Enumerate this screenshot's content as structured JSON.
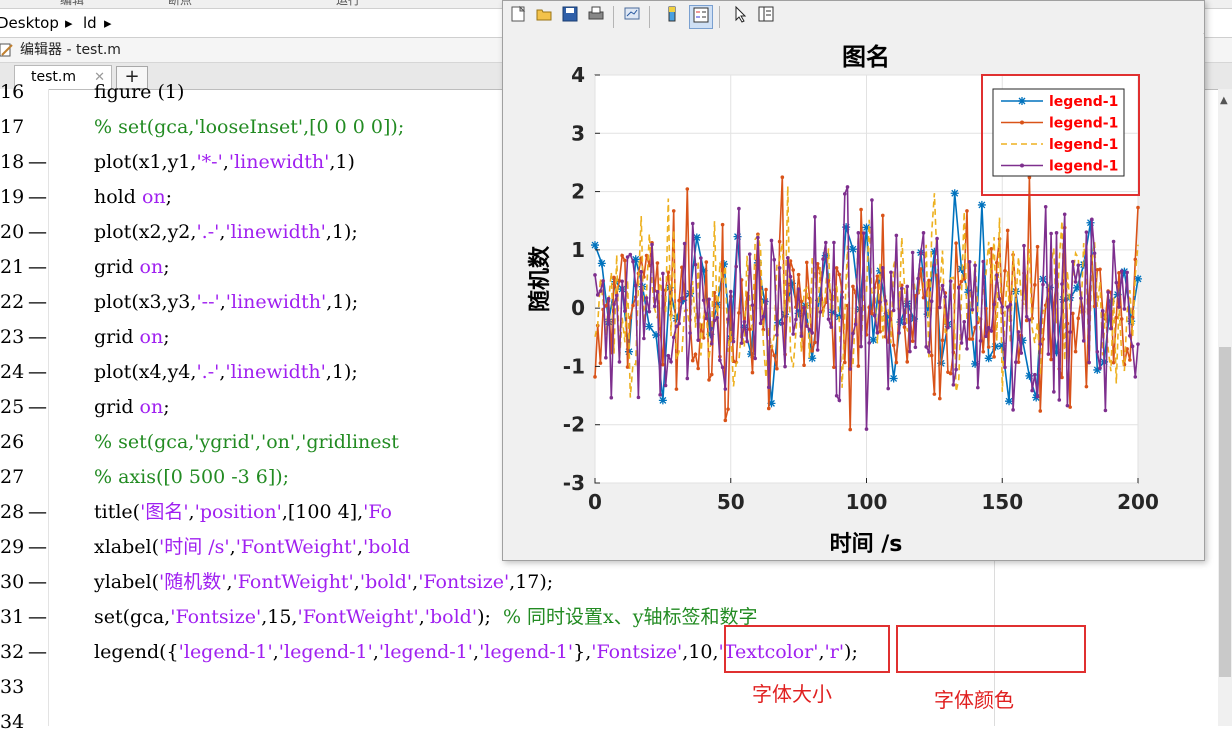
{
  "top_menu": [
    "编辑",
    "断点",
    "运行"
  ],
  "address_bar": {
    "crumbs": [
      "Desktop",
      "ld"
    ],
    "separator": "▸"
  },
  "editor": {
    "window_title": "编辑器 - test.m",
    "tab_label": "test.m",
    "tab_close": "✕",
    "new_tab": "+"
  },
  "code_lines": [
    {
      "ln": "16",
      "dash": "",
      "html": "figure (1)"
    },
    {
      "ln": "17",
      "dash": "",
      "html": "<span class=\"cm\">% set(gca,'looseInset',[0 0 0 0]);</span>"
    },
    {
      "ln": "18",
      "dash": "—",
      "html": "plot(x1,y1,<span class=\"str\">'*-'</span>,<span class=\"str\">'linewidth'</span>,1)"
    },
    {
      "ln": "19",
      "dash": "—",
      "html": "hold <span class=\"str\">on</span>;"
    },
    {
      "ln": "20",
      "dash": "—",
      "html": "plot(x2,y2,<span class=\"str\">'.-'</span>,<span class=\"str\">'linewidth'</span>,1);"
    },
    {
      "ln": "21",
      "dash": "—",
      "html": "grid <span class=\"str\">on</span>;"
    },
    {
      "ln": "22",
      "dash": "—",
      "html": "plot(x3,y3,<span class=\"str\">'--'</span>,<span class=\"str\">'linewidth'</span>,1);"
    },
    {
      "ln": "23",
      "dash": "—",
      "html": "grid <span class=\"str\">on</span>;"
    },
    {
      "ln": "24",
      "dash": "—",
      "html": "plot(x4,y4,<span class=\"str\">'.-'</span>,<span class=\"str\">'linewidth'</span>,1);"
    },
    {
      "ln": "25",
      "dash": "—",
      "html": "grid <span class=\"str\">on</span>;"
    },
    {
      "ln": "26",
      "dash": "",
      "html": "<span class=\"cm\">% set(gca,'ygrid','on','gridlinest</span>"
    },
    {
      "ln": "27",
      "dash": "",
      "html": "<span class=\"cm\">% axis([0 500 -3 6]);</span>"
    },
    {
      "ln": "28",
      "dash": "—",
      "html": "title(<span class=\"str\">'图名'</span>,<span class=\"str\">'position'</span>,[100 4],<span class=\"str\">'Fo</span>"
    },
    {
      "ln": "29",
      "dash": "—",
      "html": "xlabel(<span class=\"str\">'时间 /s'</span>,<span class=\"str\">'FontWeight'</span>,<span class=\"str\">'bold</span>"
    },
    {
      "ln": "30",
      "dash": "—",
      "html": "ylabel(<span class=\"str\">'随机数'</span>,<span class=\"str\">'FontWeight'</span>,<span class=\"str\">'bold'</span>,<span class=\"str\">'Fontsize'</span>,17);"
    },
    {
      "ln": "31",
      "dash": "—",
      "html": "set(gca,<span class=\"str\">'Fontsize'</span>,15,<span class=\"str\">'FontWeight'</span>,<span class=\"str\">'bold'</span>);&nbsp;&nbsp;<span class=\"cm\">% 同时设置x、y轴标签和数字</span>"
    },
    {
      "ln": "32",
      "dash": "—",
      "html": "legend({<span class=\"str\">'legend-1'</span>,<span class=\"str\">'legend-1'</span>,<span class=\"str\">'legend-1'</span>,<span class=\"str\">'legend-1'</span>},<span class=\"str\">'Fontsize'</span>,10,<span class=\"str\">'Textcolor'</span>,<span class=\"str\">'r'</span>);"
    },
    {
      "ln": "33",
      "dash": "",
      "html": ""
    },
    {
      "ln": "34",
      "dash": "",
      "html": ""
    }
  ],
  "annotations": {
    "font_size_label": "字体大小",
    "font_color_label": "字体颜色"
  },
  "figure": {
    "toolbar_icons": [
      "new-figure-icon",
      "open-file-icon",
      "save-icon",
      "print-icon",
      "link-plot-icon",
      "colorbar-icon",
      "legend-toggle-icon",
      "select-pointer-icon",
      "property-editor-icon"
    ]
  },
  "chart_data": {
    "type": "line",
    "title": "图名",
    "xlabel": "时间 /s",
    "ylabel": "随机数",
    "xlim": [
      0,
      200
    ],
    "ylim": [
      -3,
      4
    ],
    "xticks": [
      0,
      50,
      100,
      150,
      200
    ],
    "yticks": [
      -3,
      -2,
      -1,
      0,
      1,
      2,
      3,
      4
    ],
    "grid": true,
    "legend_placement": "top-right",
    "legend_text_color": "#ff0000",
    "series": [
      {
        "name": "legend-1",
        "color": "#0072bd",
        "style": "*-"
      },
      {
        "name": "legend-1",
        "color": "#d95319",
        "style": ".-"
      },
      {
        "name": "legend-1",
        "color": "#edb120",
        "style": "--"
      },
      {
        "name": "legend-1",
        "color": "#7e2f8e",
        "style": ".-"
      }
    ],
    "values_note_source": "random noise, approx within [-3, 2.5]"
  }
}
